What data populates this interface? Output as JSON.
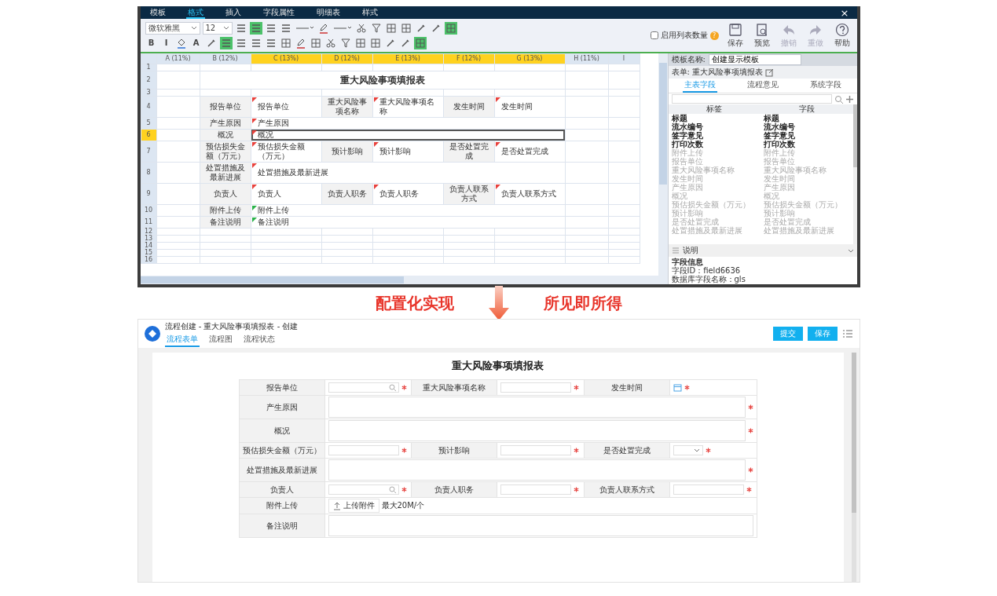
{
  "editor": {
    "menu_tabs": [
      {
        "label": "模板",
        "selected": false
      },
      {
        "label": "格式",
        "selected": true
      },
      {
        "label": "插入",
        "selected": false
      },
      {
        "label": "字段属性",
        "selected": false
      },
      {
        "label": "明细表",
        "selected": false
      },
      {
        "label": "样式",
        "selected": false
      }
    ],
    "close": "×",
    "font": "微软雅黑",
    "font_size": "12",
    "tool_rows": [
      [
        {
          "kind": "lines",
          "on": false
        },
        {
          "kind": "lines",
          "on": true
        },
        {
          "kind": "lines",
          "on": false
        },
        {
          "kind": "lines",
          "on": false
        },
        {
          "kind": "dropdown",
          "on": false
        },
        {
          "kind": "pen",
          "on": false
        },
        {
          "kind": "dropdown",
          "on": false
        },
        {
          "kind": "scissors",
          "on": false
        },
        {
          "kind": "funnel",
          "on": false
        },
        {
          "kind": "grid",
          "on": false
        },
        {
          "kind": "grid",
          "on": false
        },
        {
          "kind": "brush",
          "on": false
        },
        {
          "kind": "brush",
          "on": false
        },
        {
          "kind": "grid",
          "on": true
        }
      ],
      [
        {
          "kind": "text",
          "label": "B",
          "on": false
        },
        {
          "kind": "text",
          "label": "I",
          "on": false
        },
        {
          "kind": "bucket",
          "on": false
        },
        {
          "kind": "text",
          "label": "A",
          "on": false
        },
        {
          "kind": "brush",
          "on": false
        },
        {
          "kind": "lines",
          "on": true
        },
        {
          "kind": "lines",
          "on": false
        },
        {
          "kind": "lines",
          "on": false
        },
        {
          "kind": "lines",
          "on": false
        },
        {
          "kind": "grid",
          "on": false
        },
        {
          "kind": "pen",
          "on": false
        },
        {
          "kind": "grid",
          "on": false
        },
        {
          "kind": "scissors",
          "on": false
        },
        {
          "kind": "funnel",
          "on": false
        },
        {
          "kind": "grid",
          "on": false
        },
        {
          "kind": "grid",
          "on": false
        },
        {
          "kind": "brush",
          "on": false
        },
        {
          "kind": "brush",
          "on": false
        },
        {
          "kind": "grid",
          "on": true
        }
      ]
    ],
    "checkbox": {
      "label": "启用列表数量",
      "checked": false,
      "hint": "?"
    },
    "actions": [
      {
        "label": "保存",
        "kind": "save",
        "disabled": false
      },
      {
        "label": "预览",
        "kind": "preview",
        "disabled": false
      },
      {
        "label": "撤销",
        "kind": "undo",
        "disabled": true
      },
      {
        "label": "重做",
        "kind": "redo",
        "disabled": true
      },
      {
        "label": "帮助",
        "kind": "help",
        "disabled": false
      }
    ],
    "columns": [
      {
        "label": "A (11%)",
        "selected": false
      },
      {
        "label": "B (12%)",
        "selected": false
      },
      {
        "label": "C (13%)",
        "selected": true
      },
      {
        "label": "D (12%)",
        "selected": true
      },
      {
        "label": "E (13%)",
        "selected": true
      },
      {
        "label": "F (12%)",
        "selected": true
      },
      {
        "label": "G (13%)",
        "selected": true
      },
      {
        "label": "H (11%)",
        "selected": false
      },
      {
        "label": "I",
        "selected": false
      }
    ],
    "rows": [
      {
        "number": "1",
        "selected": false
      },
      {
        "number": "2",
        "selected": false,
        "cells": [
          {
            "kind": "empty"
          },
          {
            "kind": "title",
            "text": "重大风险事项填报表"
          },
          {
            "kind": "empty"
          },
          {
            "kind": "empty"
          }
        ]
      },
      {
        "number": "3",
        "selected": false
      },
      {
        "number": "4",
        "selected": false,
        "cells": [
          {
            "kind": "empty"
          },
          {
            "kind": "label",
            "text": "报告单位"
          },
          {
            "kind": "field",
            "text": "报告单位",
            "color": "#e8413c",
            "selected": false
          },
          {
            "kind": "label",
            "text": "重大风险事项名称"
          },
          {
            "kind": "field",
            "text": "重大风险事项名称",
            "color": "#e8413c",
            "selected": false
          },
          {
            "kind": "label",
            "text": "发生时间"
          },
          {
            "kind": "field",
            "text": "发生时间",
            "color": "#e8413c",
            "selected": false
          },
          {
            "kind": "empty"
          },
          {
            "kind": "empty"
          }
        ]
      },
      {
        "number": "5",
        "selected": false,
        "cells": [
          {
            "kind": "empty"
          },
          {
            "kind": "label",
            "text": "产生原因"
          },
          {
            "kind": "wide_field",
            "text": "产生原因",
            "color": "#e8413c",
            "selected": false
          },
          {
            "kind": "empty"
          },
          {
            "kind": "empty"
          }
        ]
      },
      {
        "number": "6",
        "selected": true,
        "cells": [
          {
            "kind": "empty"
          },
          {
            "kind": "label",
            "text": "概况"
          },
          {
            "kind": "wide_field",
            "text": "概况",
            "color": "#e8413c",
            "selected": true
          },
          {
            "kind": "empty"
          },
          {
            "kind": "empty"
          }
        ]
      },
      {
        "number": "7",
        "selected": false,
        "cells": [
          {
            "kind": "empty"
          },
          {
            "kind": "label",
            "text": "预估损失金额（万元）"
          },
          {
            "kind": "field",
            "text": "预估损失金额（万元）",
            "color": "#e8413c",
            "selected": false
          },
          {
            "kind": "label",
            "text": "预计影响"
          },
          {
            "kind": "field",
            "text": "预计影响",
            "color": "#e8413c",
            "selected": false
          },
          {
            "kind": "label",
            "text": "是否处置完成"
          },
          {
            "kind": "field",
            "text": "是否处置完成",
            "color": "#e8413c",
            "selected": false
          },
          {
            "kind": "empty"
          },
          {
            "kind": "empty"
          }
        ]
      },
      {
        "number": "8",
        "selected": false,
        "cells": [
          {
            "kind": "empty"
          },
          {
            "kind": "label",
            "text": "处置措施及最新进展"
          },
          {
            "kind": "wide_field",
            "text": "处置措施及最新进展",
            "color": "#e8413c",
            "selected": false
          },
          {
            "kind": "empty"
          },
          {
            "kind": "empty"
          }
        ]
      },
      {
        "number": "9",
        "selected": false,
        "cells": [
          {
            "kind": "empty"
          },
          {
            "kind": "label",
            "text": "负责人"
          },
          {
            "kind": "field",
            "text": "负责人",
            "color": "#e8413c",
            "selected": false
          },
          {
            "kind": "label",
            "text": "负责人职务"
          },
          {
            "kind": "field",
            "text": "负责人职务",
            "color": "#e8413c",
            "selected": false
          },
          {
            "kind": "label",
            "text": "负责人联系方式"
          },
          {
            "kind": "field",
            "text": "负责人联系方式",
            "color": "#e8413c",
            "selected": false
          },
          {
            "kind": "empty"
          },
          {
            "kind": "empty"
          }
        ]
      },
      {
        "number": "10",
        "selected": false,
        "cells": [
          {
            "kind": "empty"
          },
          {
            "kind": "label",
            "text": "附件上传"
          },
          {
            "kind": "wide_field",
            "text": "附件上传",
            "color": "#2bb34a",
            "selected": false
          },
          {
            "kind": "empty"
          },
          {
            "kind": "empty"
          }
        ]
      },
      {
        "number": "11",
        "selected": false,
        "cells": [
          {
            "kind": "empty"
          },
          {
            "kind": "label",
            "text": "备注说明"
          },
          {
            "kind": "wide_field",
            "text": "备注说明",
            "color": "#2bb34a",
            "selected": false
          },
          {
            "kind": "empty"
          },
          {
            "kind": "empty"
          }
        ]
      },
      {
        "number": "12",
        "selected": false
      },
      {
        "number": "13",
        "selected": false
      },
      {
        "number": "14",
        "selected": false
      },
      {
        "number": "15",
        "selected": false
      },
      {
        "number": "16",
        "selected": false
      }
    ],
    "panel": {
      "template_label": "模板名称:",
      "template_name": "创建显示模板",
      "form_label": "表单:",
      "form_name": "重大风险事项填报表",
      "tabs": [
        {
          "label": "主表字段",
          "selected": true
        },
        {
          "label": "流程意见",
          "selected": false
        },
        {
          "label": "系统字段",
          "selected": false
        }
      ],
      "list_headers": [
        "标签",
        "字段"
      ],
      "fields": [
        {
          "label": "标题",
          "field": "标题",
          "placed": false
        },
        {
          "label": "流水编号",
          "field": "流水编号",
          "placed": false
        },
        {
          "label": "签字意见",
          "field": "签字意见",
          "placed": false
        },
        {
          "label": "打印次数",
          "field": "打印次数",
          "placed": false
        },
        {
          "label": "附件上传",
          "field": "附件上传",
          "placed": true
        },
        {
          "label": "报告单位",
          "field": "报告单位",
          "placed": true
        },
        {
          "label": "重大风险事项名称",
          "field": "重大风险事项名称",
          "placed": true
        },
        {
          "label": "发生时间",
          "field": "发生时间",
          "placed": true
        },
        {
          "label": "产生原因",
          "field": "产生原因",
          "placed": true
        },
        {
          "label": "概况",
          "field": "概况",
          "placed": true
        },
        {
          "label": "预估损失金额（万元）",
          "field": "预估损失金额（万元）",
          "placed": true
        },
        {
          "label": "预计影响",
          "field": "预计影响",
          "placed": true
        },
        {
          "label": "是否处置完成",
          "field": "是否处置完成",
          "placed": true
        },
        {
          "label": "处置措施及最新进展",
          "field": "处置措施及最新进展",
          "placed": true
        }
      ],
      "notes_title": "说明",
      "info_title": "字段信息",
      "info_lines": [
        "字段ID：field6636",
        "数据库字段名称：gls"
      ]
    }
  },
  "captions": [
    "配置化实现",
    "所见即所得"
  ],
  "app": {
    "breadcrumb": "流程创建 - 重大风险事项填报表 - 创建",
    "tabs": [
      {
        "label": "流程表单",
        "selected": true
      },
      {
        "label": "流程图",
        "selected": false
      },
      {
        "label": "流程状态",
        "selected": false
      }
    ],
    "buttons": [
      "提交",
      "保存"
    ],
    "form": {
      "title": "重大风险事项填报表",
      "rows": [
        [
          {
            "label": "报告单位",
            "kind": "search",
            "required": true
          },
          {
            "label": "重大风险事项名称",
            "kind": "text",
            "required": true
          },
          {
            "label": "发生时间",
            "kind": "date",
            "required": true
          }
        ],
        [
          {
            "label": "产生原因",
            "kind": "textarea",
            "required": true
          }
        ],
        [
          {
            "label": "概况",
            "kind": "textarea",
            "required": true
          }
        ],
        [
          {
            "label": "预估损失金额（万元）",
            "kind": "text",
            "required": true
          },
          {
            "label": "预计影响",
            "kind": "text",
            "required": true
          },
          {
            "label": "是否处置完成",
            "kind": "select",
            "required": true
          }
        ],
        [
          {
            "label": "处置措施及最新进展",
            "kind": "textarea",
            "required": true
          }
        ],
        [
          {
            "label": "负责人",
            "kind": "search",
            "required": true
          },
          {
            "label": "负责人职务",
            "kind": "text",
            "required": true
          },
          {
            "label": "负责人联系方式",
            "kind": "text",
            "required": true
          }
        ],
        [
          {
            "label": "附件上传",
            "kind": "upload",
            "button": "上传附件",
            "note": "最大20M/个",
            "required": false
          }
        ],
        [
          {
            "label": "备注说明",
            "kind": "textarea",
            "required": false
          }
        ]
      ]
    }
  }
}
